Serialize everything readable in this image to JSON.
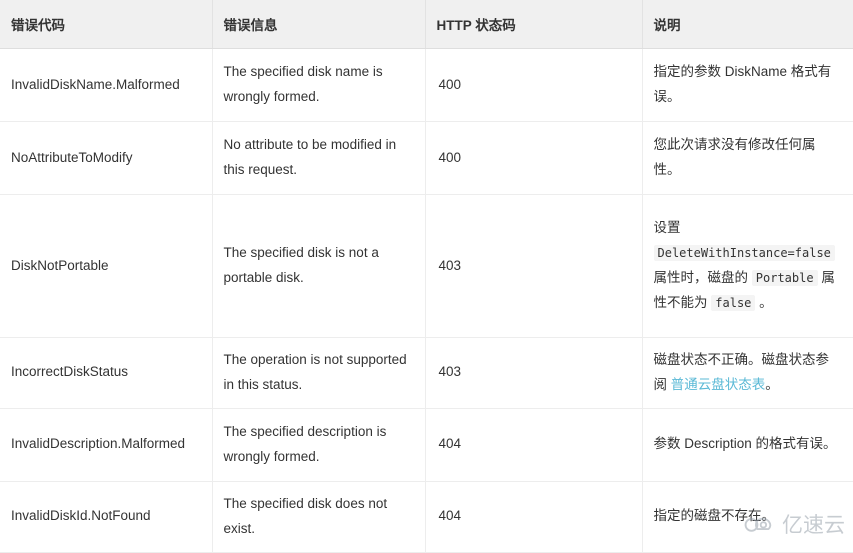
{
  "table": {
    "headers": [
      "错误代码",
      "错误信息",
      "HTTP 状态码",
      "说明"
    ],
    "rows": [
      {
        "code": "InvalidDiskName.Malformed",
        "message": "The specified disk name is wrongly formed.",
        "status": "400",
        "description": "指定的参数 DiskName 格式有误。"
      },
      {
        "code": "NoAttributeToModify",
        "message": "No attribute to be modified in this request.",
        "status": "400",
        "description": "您此次请求没有修改任何属性。"
      },
      {
        "code": "DiskNotPortable",
        "message": "The specified disk is not a portable disk.",
        "status": "403",
        "description_parts": {
          "prefix": "设置",
          "code1": "DeleteWithInstance=false",
          "middle1": "属性时，磁盘的",
          "code2": "Portable",
          "middle2": "属性不能为",
          "code3": "false",
          "suffix": "。"
        }
      },
      {
        "code": "IncorrectDiskStatus",
        "message": "The operation is not supported in this status.",
        "status": "403",
        "description_parts": {
          "prefix": "磁盘状态不正确。磁盘状态参阅",
          "link": "普通云盘状态表",
          "suffix": "。"
        }
      },
      {
        "code": "InvalidDescription.Malformed",
        "message": "The specified description is wrongly formed.",
        "status": "404",
        "description": "参数 Description 的格式有误。"
      },
      {
        "code": "InvalidDiskId.NotFound",
        "message": "The specified disk does not exist.",
        "status": "404",
        "description": "指定的磁盘不存在。"
      }
    ]
  },
  "watermark": {
    "text": "亿速云",
    "logo": "cloud-logo-icon"
  },
  "colors": {
    "link": "#5ab9d6",
    "header_bg": "#f0f0f0",
    "code_bg": "#f4f4f4",
    "text": "#333333",
    "border": "#ededed"
  }
}
